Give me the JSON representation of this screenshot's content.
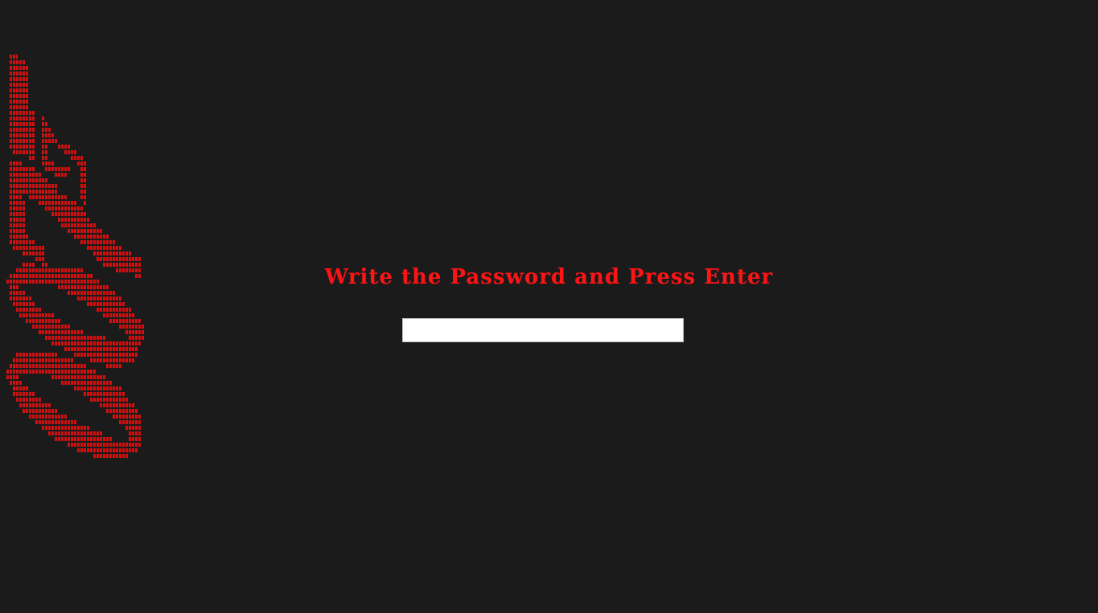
{
  "prompt": {
    "title": "Write the Password and Press Enter"
  },
  "password_field": {
    "value": "",
    "placeholder": ""
  },
  "colors": {
    "background": "#1b1b1c",
    "accent": "#ff1414",
    "art": "#d21010"
  },
  "icons": {
    "art": "red-ascii-art-icon"
  }
}
